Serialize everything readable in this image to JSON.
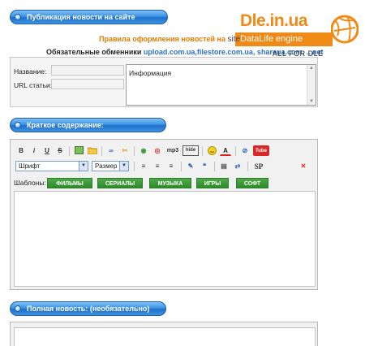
{
  "header1": {
    "title": "Публикация новости на сайте"
  },
  "logo": {
    "name": "Dle.in.ua",
    "tagline": "DataLife engine"
  },
  "rules": {
    "text": "Правила оформления новостей на",
    "site": "site"
  },
  "exchangers": {
    "label": "Обязательные обменники",
    "links": "upload.com.ua,filestore.com.ua, shareua.com, ...net"
  },
  "allfor": "ALL FOR DLE",
  "form": {
    "name_label": "Название:",
    "url_label": "URL статьи:",
    "name_value": "",
    "url_value": "",
    "info_text": "Информация"
  },
  "header2": {
    "title": "Краткое содержание:"
  },
  "editor": {
    "toolbar_row1": [
      "B",
      "i",
      "U",
      "S",
      "img",
      "folder",
      "link",
      "unlink",
      "flash",
      "media",
      "mp3",
      "hide",
      "smile",
      "color",
      "ie",
      "youtube"
    ],
    "font_select": "Шрифт",
    "size_select": "Размер",
    "toolbar_row2": [
      "align-left",
      "align-center",
      "align-right",
      "edit",
      "quote",
      "page",
      "spoiler",
      "SP",
      "clear"
    ],
    "templates_label": "Шаблоны:",
    "templates": [
      "ФИЛЬМЫ",
      "СЕРИАЛЫ",
      "МУЗЫКА",
      "ИГРЫ",
      "СОФТ"
    ]
  },
  "header3": {
    "title": "Полная новость: (необязательно)"
  },
  "colors": {
    "accent": "#3d93e3",
    "brand_orange": "#f08a16",
    "template_green": "#3a9836"
  }
}
